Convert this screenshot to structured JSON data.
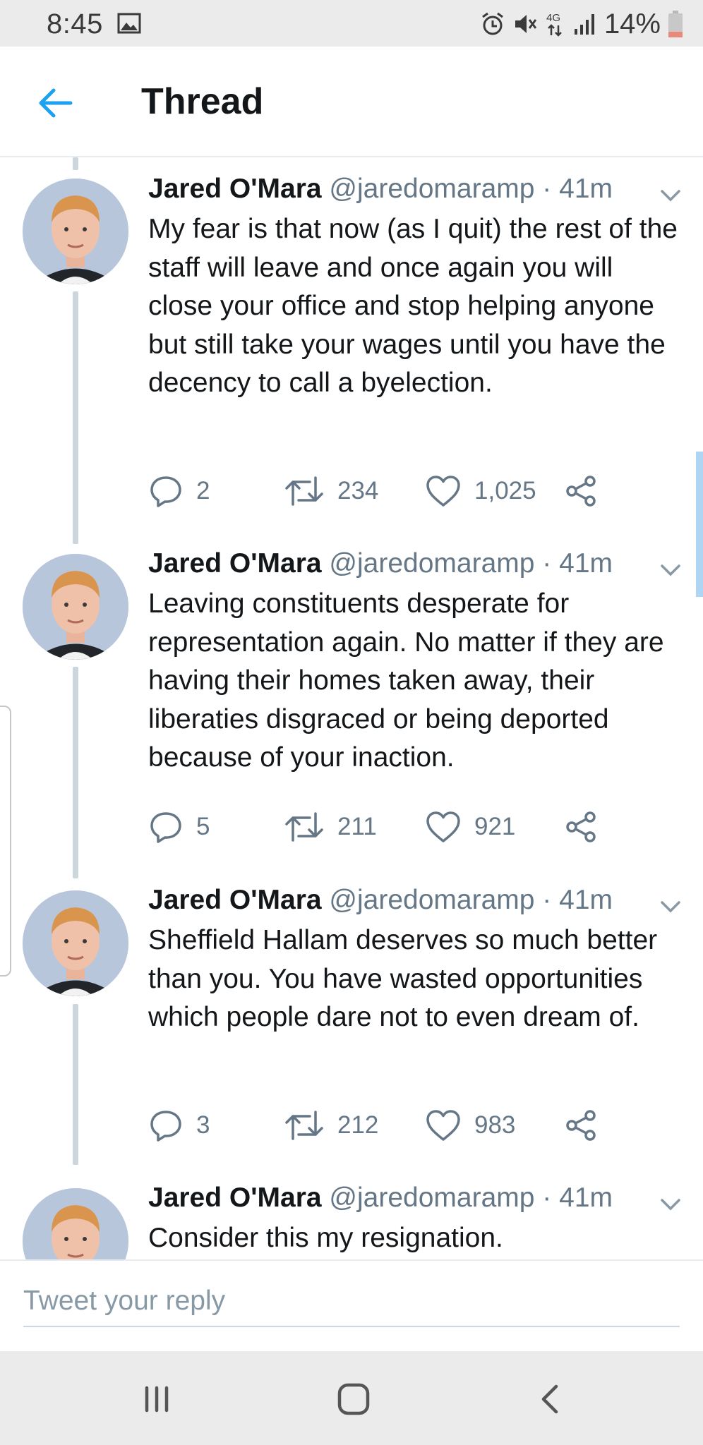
{
  "status": {
    "time": "8:45",
    "battery": "14%",
    "network": "4G"
  },
  "header": {
    "title": "Thread"
  },
  "tweets": [
    {
      "name": "Jared O'Mara",
      "handle": "@jaredomaramp",
      "dot": "·",
      "time": "41m",
      "text": "My fear is that now (as I quit) the rest of the staff will leave and once again you will close your office and stop helping anyone but still take your wages until you have the decency to call a byelection.",
      "replies": "2",
      "retweets": "234",
      "likes": "1,025"
    },
    {
      "name": "Jared O'Mara",
      "handle": "@jaredomaramp",
      "dot": "·",
      "time": "41m",
      "text": "Leaving constituents desperate for representation again. No matter if they are having their homes taken away, their liberaties disgraced or being deported because of your inaction.",
      "replies": "5",
      "retweets": "211",
      "likes": "921"
    },
    {
      "name": "Jared O'Mara",
      "handle": "@jaredomaramp",
      "dot": "·",
      "time": "41m",
      "text": "Sheffield Hallam deserves so much better than you. You have wasted opportunities which people dare not to even dream of.",
      "replies": "3",
      "retweets": "212",
      "likes": "983"
    },
    {
      "name": "Jared O'Mara",
      "handle": "@jaredomaramp",
      "dot": "·",
      "time": "41m",
      "text": "Consider this my resignation."
    }
  ],
  "reply": {
    "placeholder": "Tweet your reply"
  },
  "icons": {
    "back": "arrow-left-icon",
    "caret": "chevron-down-icon",
    "reply": "speech-bubble-icon",
    "retweet": "retweet-icon",
    "like": "heart-icon",
    "share": "share-icon",
    "recents": "recent-apps-icon",
    "home": "home-icon",
    "nav_back": "back-chevron-icon"
  },
  "colors": {
    "accent": "#1da1f2",
    "secondary_text": "#657786",
    "thread_line": "#ccd6dd",
    "battery_low": "#e8897a"
  }
}
